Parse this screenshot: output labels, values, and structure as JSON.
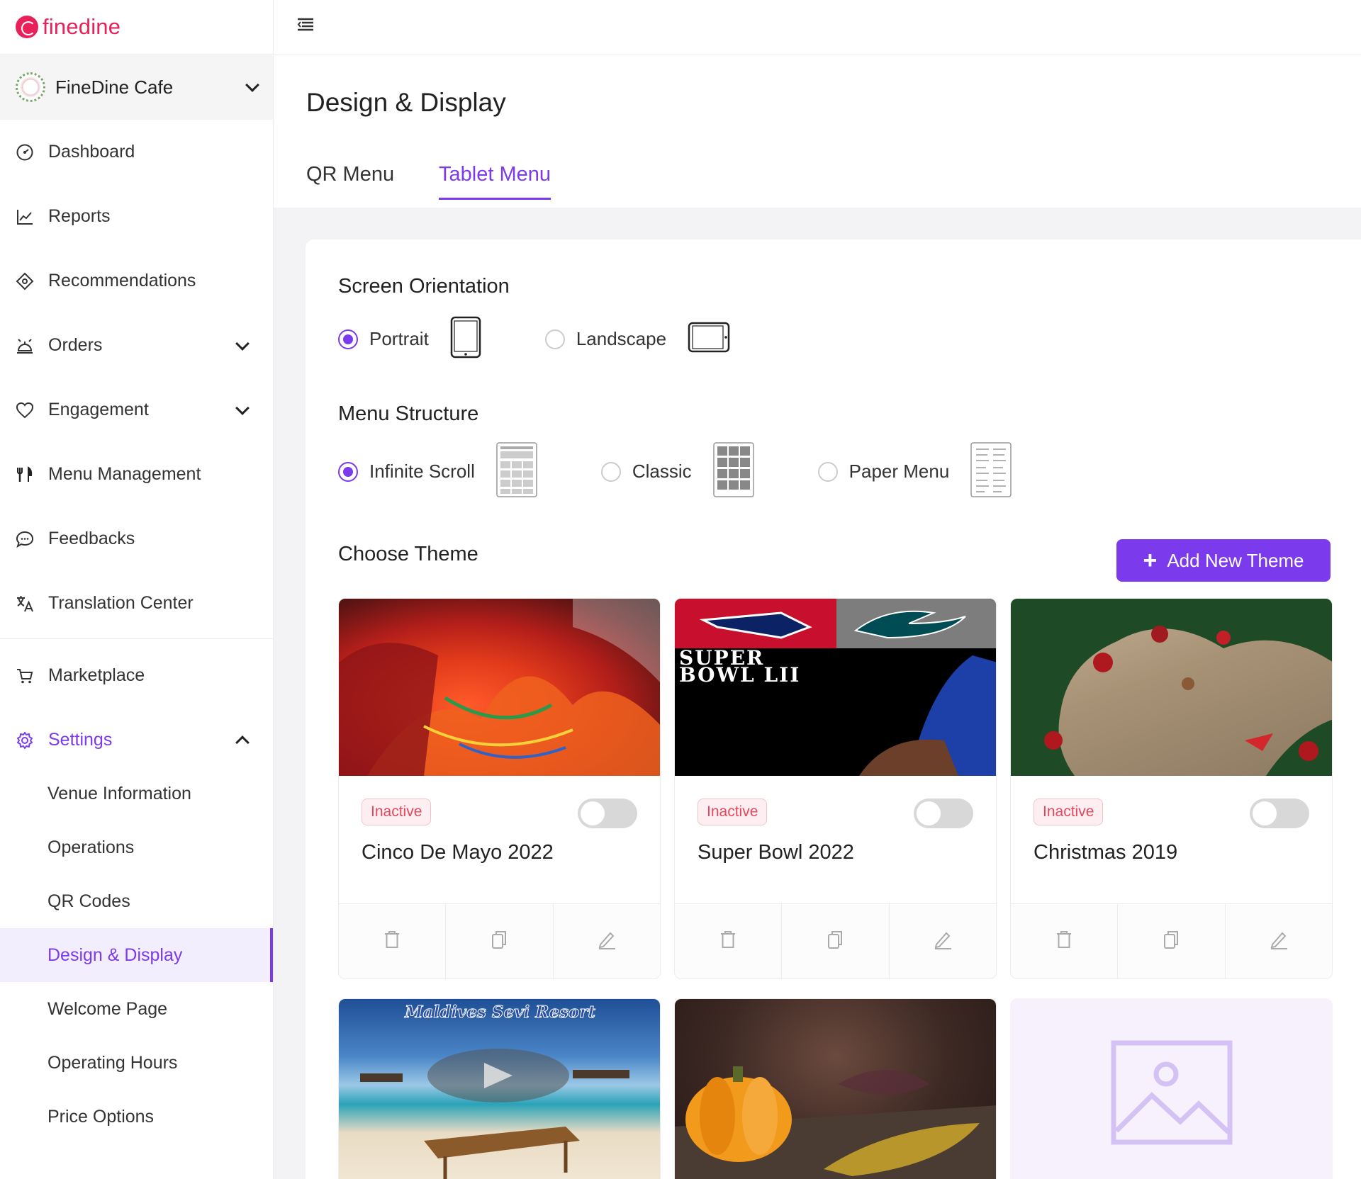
{
  "brand": {
    "name": "finedine",
    "color": "#e9215a"
  },
  "venue": {
    "name": "FineDine Cafe"
  },
  "nav": {
    "dashboard": "Dashboard",
    "reports": "Reports",
    "recommendations": "Recommendations",
    "orders": "Orders",
    "engagement": "Engagement",
    "menu_management": "Menu Management",
    "feedbacks": "Feedbacks",
    "translation_center": "Translation Center",
    "marketplace": "Marketplace",
    "settings": "Settings"
  },
  "settings_sub": {
    "venue_information": "Venue Information",
    "operations": "Operations",
    "qr_codes": "QR Codes",
    "design_display": "Design & Display",
    "welcome_page": "Welcome Page",
    "operating_hours": "Operating Hours",
    "price_options": "Price Options"
  },
  "page": {
    "title": "Design & Display",
    "tabs": {
      "qr_menu": "QR Menu",
      "tablet_menu": "Tablet Menu"
    }
  },
  "orientation": {
    "title": "Screen Orientation",
    "portrait": "Portrait",
    "landscape": "Landscape",
    "selected": "Portrait"
  },
  "structure": {
    "title": "Menu Structure",
    "infinite_scroll": "Infinite Scroll",
    "classic": "Classic",
    "paper_menu": "Paper Menu",
    "selected": "Infinite Scroll"
  },
  "themes": {
    "title": "Choose Theme",
    "add_label": "Add New Theme",
    "items": [
      {
        "name": "Cinco De Mayo 2022",
        "status": "Inactive"
      },
      {
        "name": "Super Bowl 2022",
        "status": "Inactive",
        "image_text": "SUPER BOWL LII"
      },
      {
        "name": "Christmas 2019",
        "status": "Inactive"
      },
      {
        "image_text": "Maldives Sevi Resort"
      }
    ]
  },
  "colors": {
    "accent": "#7c3aed",
    "inactive": "#e5475f"
  }
}
